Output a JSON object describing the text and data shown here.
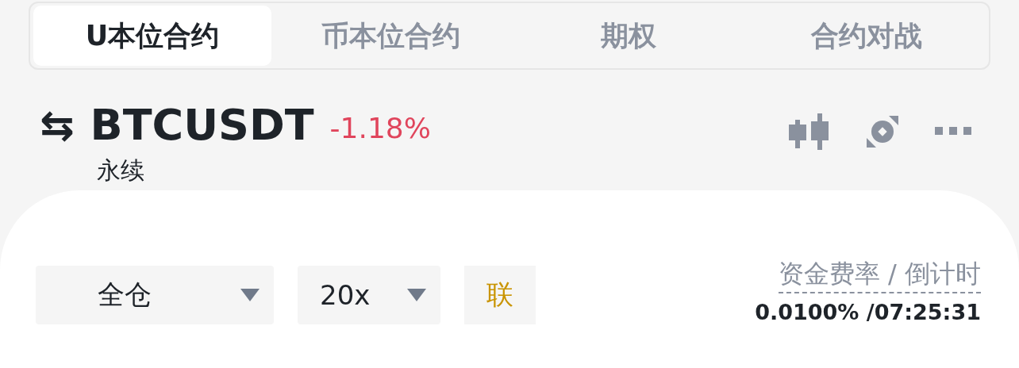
{
  "tabs": [
    {
      "label": "U本位合约",
      "selected": true
    },
    {
      "label": "币本位合约",
      "selected": false
    },
    {
      "label": "期权",
      "selected": false
    },
    {
      "label": "合约对战",
      "selected": false
    }
  ],
  "symbol": {
    "swap_icon": "⇆",
    "name": "BTCUSDT",
    "change": "-1.18%",
    "type": "永续"
  },
  "controls": [
    {
      "kind": "dropdown",
      "label": "全仓"
    },
    {
      "kind": "dropdown",
      "label": "20x"
    },
    {
      "kind": "tag",
      "label": "联"
    }
  ],
  "funding": {
    "label": "资金费率 / 倒计时",
    "value": "0.0100% /07:25:31"
  }
}
